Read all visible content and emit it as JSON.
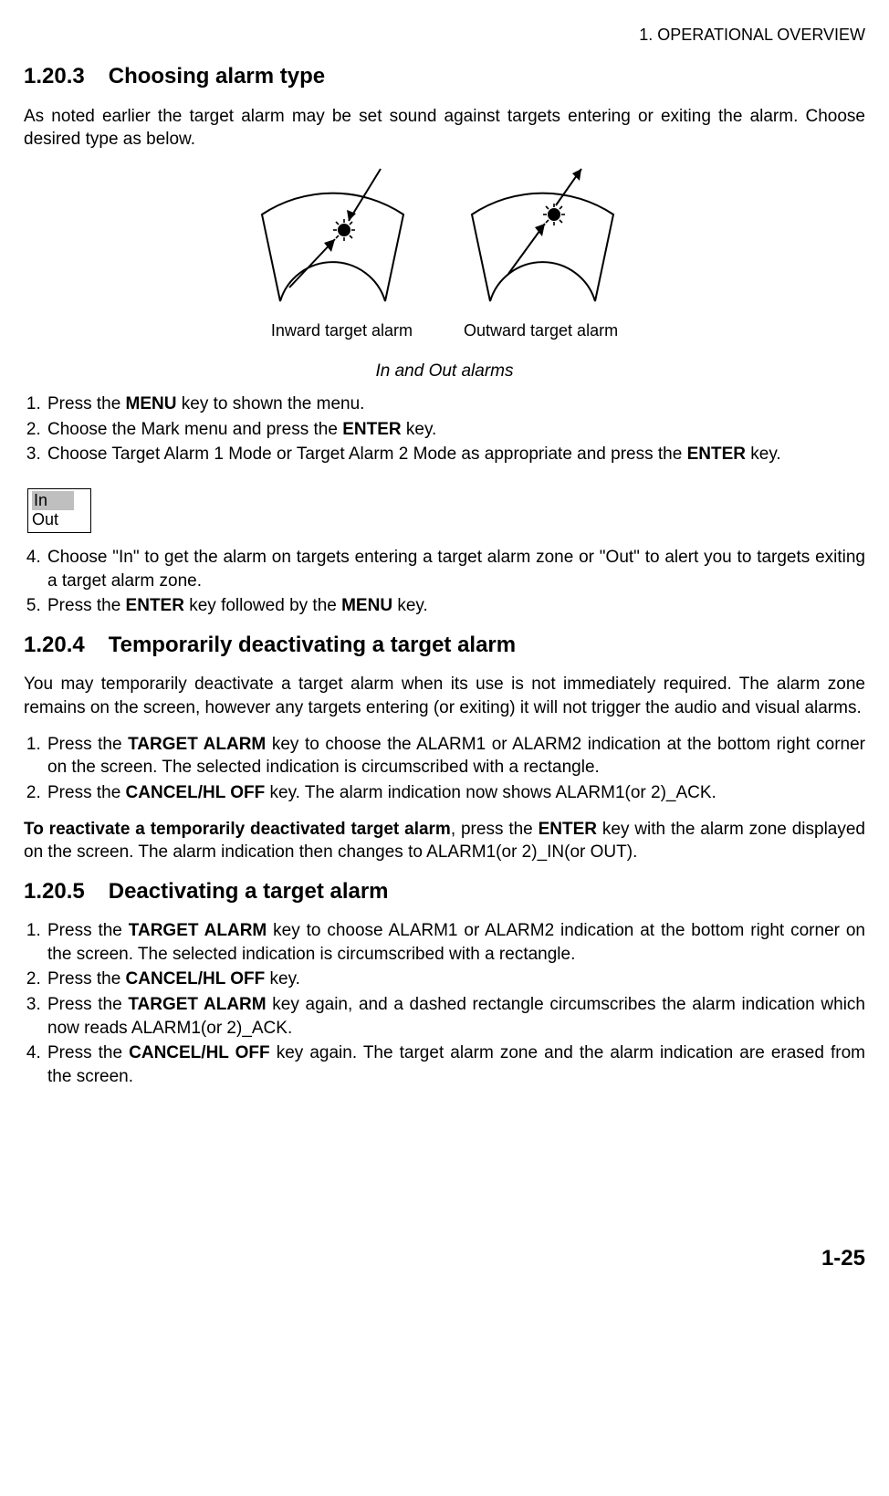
{
  "running_header": "1.  OPERATIONAL OVERVIEW",
  "section_1203": {
    "number": "1.20.3",
    "title": "Choosing alarm type",
    "intro": "As noted earlier the target alarm may be set sound against targets entering or exiting the alarm. Choose desired type as below.",
    "fig_label_left": "Inward target alarm",
    "fig_label_right": "Outward target alarm",
    "fig_caption": "In and Out alarms",
    "step1_pre": "Press the ",
    "step1_bold": "MENU",
    "step1_post": " key to shown the menu.",
    "step2_pre": "Choose the Mark menu and press the ",
    "step2_bold": "ENTER",
    "step2_post": " key.",
    "step3_pre": "Choose Target Alarm 1 Mode or Target Alarm 2 Mode as appropriate and press the ",
    "step3_bold": "ENTER",
    "step3_post": " key.",
    "menu_in": "In",
    "menu_out": "Out",
    "step4": "Choose \"In\" to get the alarm on targets entering a target alarm zone or \"Out\" to alert you to targets exiting a target alarm zone.",
    "step5_pre": "Press the ",
    "step5_bold1": "ENTER",
    "step5_mid": " key followed by the ",
    "step5_bold2": "MENU",
    "step5_post": " key."
  },
  "section_1204": {
    "number": "1.20.4",
    "title": "Temporarily deactivating a target alarm",
    "intro": "You may temporarily deactivate a target alarm when its use is not immediately required. The alarm zone remains on the screen, however any targets entering (or exiting) it will not trigger the audio and visual alarms.",
    "step1_pre": "Press the ",
    "step1_bold": "TARGET ALARM",
    "step1_post": " key to choose the ALARM1 or ALARM2 indication at the bottom right corner on the screen. The selected indication is circumscribed with a rectangle.",
    "step2_pre": "Press the ",
    "step2_bold": "CANCEL/HL OFF",
    "step2_post": " key. The alarm indication now shows ALARM1(or 2)_ACK.",
    "react_bold": "To reactivate a temporarily deactivated target alarm",
    "react_mid1": ", press the ",
    "react_bold2": "ENTER",
    "react_post": " key with the alarm zone displayed on the screen. The alarm indication then changes to ALARM1(or 2)_IN(or OUT)."
  },
  "section_1205": {
    "number": "1.20.5",
    "title": "Deactivating a target alarm",
    "step1_pre": "Press the ",
    "step1_bold": "TARGET ALARM",
    "step1_post": " key to choose ALARM1 or ALARM2 indication at the bottom right corner on the screen. The selected indication is circumscribed with a rectangle.",
    "step2_pre": "Press the ",
    "step2_bold": "CANCEL/HL OFF",
    "step2_post": " key.",
    "step3_pre": "Press the ",
    "step3_bold": "TARGET ALARM",
    "step3_post": " key again, and a dashed rectangle circumscribes the alarm indication which now reads ALARM1(or 2)_ACK.",
    "step4_pre": "Press the ",
    "step4_bold": "CANCEL/HL OFF",
    "step4_post": " key again. The target alarm zone and the alarm indication are erased from the screen."
  },
  "page_number": "1-25"
}
